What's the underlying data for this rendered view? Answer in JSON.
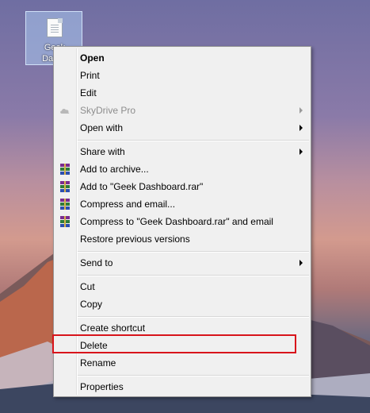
{
  "desktop_icon": {
    "label": "Geek Dashboard.rar",
    "visible_label_top": "Geek",
    "visible_label_bottom": "Dashb"
  },
  "menu": {
    "items": [
      {
        "label": "Open",
        "bold": true
      },
      {
        "label": "Print"
      },
      {
        "label": "Edit"
      },
      {
        "label": "SkyDrive Pro",
        "disabled": true,
        "submenu": true,
        "icon": "cloud-icon"
      },
      {
        "label": "Open with",
        "submenu": true
      },
      {
        "label": "Share with",
        "submenu": true
      },
      {
        "label": "Add to archive...",
        "icon": "winrar-icon"
      },
      {
        "label": "Add to \"Geek Dashboard.rar\"",
        "icon": "winrar-icon"
      },
      {
        "label": "Compress and email...",
        "icon": "winrar-icon"
      },
      {
        "label": "Compress to \"Geek Dashboard.rar\" and email",
        "icon": "winrar-icon"
      },
      {
        "label": "Restore previous versions"
      },
      {
        "label": "Send to",
        "submenu": true
      },
      {
        "label": "Cut"
      },
      {
        "label": "Copy"
      },
      {
        "label": "Create shortcut"
      },
      {
        "label": "Delete",
        "highlighted": true
      },
      {
        "label": "Rename"
      },
      {
        "label": "Properties"
      }
    ]
  },
  "colors": {
    "highlight_border": "#d8141b",
    "menu_bg": "#f0f0f0"
  }
}
